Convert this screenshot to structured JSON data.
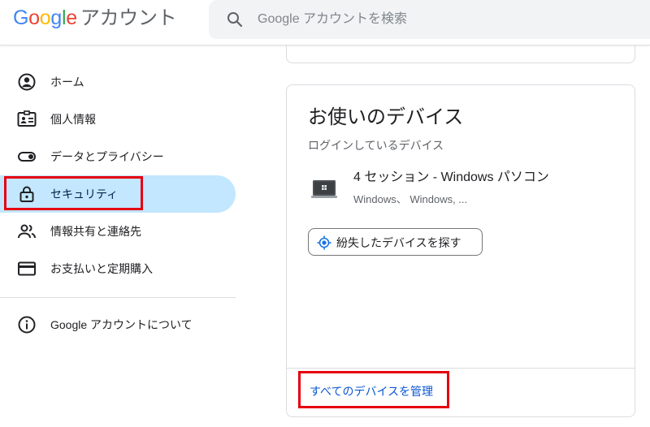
{
  "header": {
    "logo_letters": [
      "G",
      "o",
      "o",
      "g",
      "l",
      "e"
    ],
    "logo_colors": [
      "#4285f4",
      "#ea4335",
      "#fbbc05",
      "#4285f4",
      "#34a853",
      "#ea4335"
    ],
    "product_name": "アカウント",
    "search_placeholder": "Google アカウントを検索",
    "search_value": ""
  },
  "sidebar": {
    "items": [
      {
        "label": "ホーム",
        "icon": "account-circle-icon",
        "active": false
      },
      {
        "label": "個人情報",
        "icon": "id-card-icon",
        "active": false
      },
      {
        "label": "データとプライバシー",
        "icon": "toggle-icon",
        "active": false
      },
      {
        "label": "セキュリティ",
        "icon": "lock-icon",
        "active": true
      },
      {
        "label": "情報共有と連絡先",
        "icon": "people-icon",
        "active": false
      },
      {
        "label": "お支払いと定期購入",
        "icon": "credit-card-icon",
        "active": false
      }
    ],
    "about_label": "Google アカウントについて",
    "about_icon": "info-icon",
    "active_color": "#c2e7ff"
  },
  "devices_card": {
    "title": "お使いのデバイス",
    "subtitle": "ログインしているデバイス",
    "device_name": "4 セッション - Windows パソコン",
    "device_os": "Windows、 Windows, ...",
    "device_icon": "windows-laptop-icon",
    "find_button_label": "紛失したデバイスを探す",
    "find_button_icon": "location-target-icon",
    "manage_link_label": "すべてのデバイスを管理",
    "link_color": "#0b57d0"
  },
  "annotation_color": "#e5000f"
}
